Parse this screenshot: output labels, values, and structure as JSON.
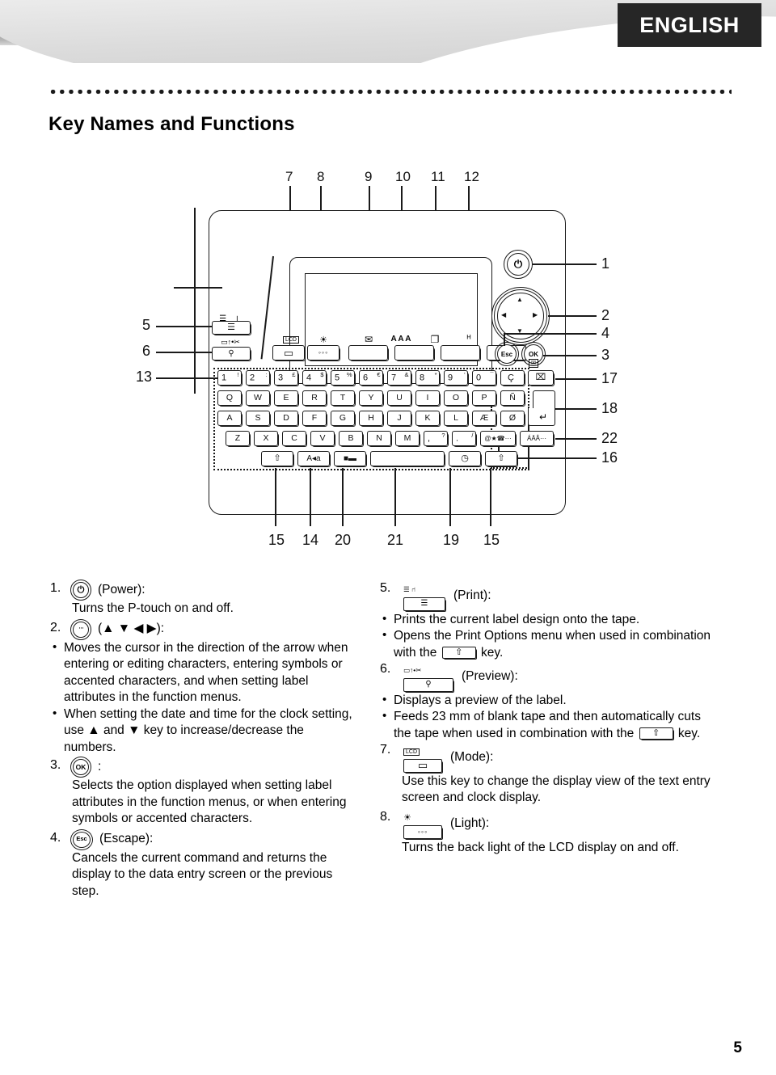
{
  "header": {
    "language_badge": "ENGLISH"
  },
  "page_title": "Key Names and Functions",
  "page_number": "5",
  "diagram": {
    "callouts_top": [
      "7",
      "8",
      "9",
      "10",
      "11",
      "12"
    ],
    "callouts_left": [
      "5",
      "6",
      "13"
    ],
    "callouts_right": [
      "1",
      "2",
      "4",
      "3",
      "17",
      "18",
      "22",
      "16"
    ],
    "callouts_bottom": [
      "15",
      "14",
      "20",
      "21",
      "19",
      "15"
    ],
    "function_keys": [
      {
        "name": "mode-key",
        "cap": "LCD",
        "face": "▭"
      },
      {
        "name": "light-key",
        "cap": "☀",
        "face": "◦◦◦"
      },
      {
        "name": "file-key",
        "cap": "✉",
        "face": ""
      },
      {
        "name": "text-key",
        "cap": "A A A",
        "face": ""
      },
      {
        "name": "label-key",
        "cap": "❐",
        "face": ""
      },
      {
        "name": "setup-key",
        "cap": "ᴴ",
        "face": ""
      }
    ],
    "print_key": {
      "cap": "☰ ।",
      "face": "☰",
      "label": "Print"
    },
    "preview_key": {
      "cap": "▭↑•✂",
      "face": "⚲",
      "label": "Preview"
    },
    "power_key": "⏻",
    "esc_key": "Esc",
    "ok_key": "OK",
    "bs_key_cap": "⌧",
    "enter_key": "↵",
    "keyboard_rows": [
      [
        {
          "main": "1",
          "shift": "!"
        },
        {
          "main": "2",
          "shift": ":"
        },
        {
          "main": "3",
          "shift": "£"
        },
        {
          "main": "4",
          "shift": "$"
        },
        {
          "main": "5",
          "shift": "%"
        },
        {
          "main": "6",
          "shift": "€"
        },
        {
          "main": "7",
          "shift": "&"
        },
        {
          "main": "8",
          "shift": "*"
        },
        {
          "main": "9",
          "shift": "'"
        },
        {
          "main": "0",
          "shift": "¯"
        },
        {
          "main": "Ç",
          "shift": ""
        }
      ],
      [
        {
          "main": "Q"
        },
        {
          "main": "W"
        },
        {
          "main": "E"
        },
        {
          "main": "R"
        },
        {
          "main": "T"
        },
        {
          "main": "Y"
        },
        {
          "main": "U"
        },
        {
          "main": "I"
        },
        {
          "main": "O"
        },
        {
          "main": "P"
        },
        {
          "main": "Ñ"
        }
      ],
      [
        {
          "main": "A"
        },
        {
          "main": "S"
        },
        {
          "main": "D"
        },
        {
          "main": "F"
        },
        {
          "main": "G"
        },
        {
          "main": "H"
        },
        {
          "main": "J"
        },
        {
          "main": "K"
        },
        {
          "main": "L"
        },
        {
          "main": "Æ"
        },
        {
          "main": "Ø"
        }
      ],
      [
        {
          "main": "Z"
        },
        {
          "main": "X"
        },
        {
          "main": "C"
        },
        {
          "main": "V"
        },
        {
          "main": "B"
        },
        {
          "main": "N"
        },
        {
          "main": "M"
        },
        {
          "main": ",",
          "shift": "?"
        },
        {
          "main": ".",
          "shift": "/"
        },
        {
          "main": "@★☎···"
        },
        {
          "main": "ÁÄÂ···"
        }
      ]
    ],
    "bottom_row": [
      {
        "name": "shift-left-key",
        "label": "⇧"
      },
      {
        "name": "caps-key",
        "label": "A◂a"
      },
      {
        "name": "label-type-key",
        "label": "■▬"
      },
      {
        "name": "space-key",
        "label": ""
      },
      {
        "name": "clock-key",
        "label": "◷"
      },
      {
        "name": "shift-right-key",
        "label": "⇧"
      }
    ]
  },
  "entries": {
    "left": [
      {
        "num": "1.",
        "icon_type": "round",
        "icon_label": "⏻",
        "name": "(Power):",
        "paragraphs": [
          "Turns the P-touch on and off."
        ],
        "bullets": []
      },
      {
        "num": "2.",
        "icon_type": "dpad",
        "icon_label": "",
        "name": "(▲ ▼ ◀ ▶):",
        "paragraphs": [],
        "bullets": [
          "Moves the cursor in the direction of the arrow when entering or editing characters, entering symbols or accented characters, and when setting label attributes in the function menus.",
          "When setting the date and time for the clock setting, use ▲ and ▼ key to increase/decrease the numbers."
        ]
      },
      {
        "num": "3.",
        "icon_type": "round",
        "icon_label": "OK",
        "name": ":",
        "paragraphs": [
          "Selects the option displayed when setting label attributes in the function menus, or when entering symbols or accented characters."
        ],
        "bullets": []
      },
      {
        "num": "4.",
        "icon_type": "round",
        "icon_label": "Esc",
        "name": "(Escape):",
        "paragraphs": [
          "Cancels the current command and returns the display to the data entry screen or the previous step."
        ],
        "bullets": []
      }
    ],
    "right": [
      {
        "num": "5.",
        "icon_type": "key",
        "icon_top": "☰ ⑁",
        "icon_face": "☰",
        "name": "(Print):",
        "paragraphs": [],
        "bullets": [
          "Prints the current label design onto the tape.",
          "Opens the Print Options menu when used in combination with the ⇧ key."
        ]
      },
      {
        "num": "6.",
        "icon_type": "key",
        "icon_top": "▭↑•✂",
        "icon_face": "⚲",
        "name": "(Preview):",
        "paragraphs": [],
        "bullets": [
          "Displays a preview of the label.",
          "Feeds 23 mm of blank tape and then automatically cuts the tape when used in combination with the ⇧ key."
        ]
      },
      {
        "num": "7.",
        "icon_type": "key",
        "icon_top": "LCD",
        "icon_face": "▭",
        "name": "(Mode):",
        "paragraphs": [
          "Use this key to change the display view of the text entry screen and clock display."
        ],
        "bullets": []
      },
      {
        "num": "8.",
        "icon_type": "key",
        "icon_top": "☀",
        "icon_face": "◦◦◦",
        "name": "(Light):",
        "paragraphs": [
          "Turns the back light of the LCD display on and off."
        ],
        "bullets": []
      }
    ],
    "shift_key_symbol": "⇧"
  }
}
